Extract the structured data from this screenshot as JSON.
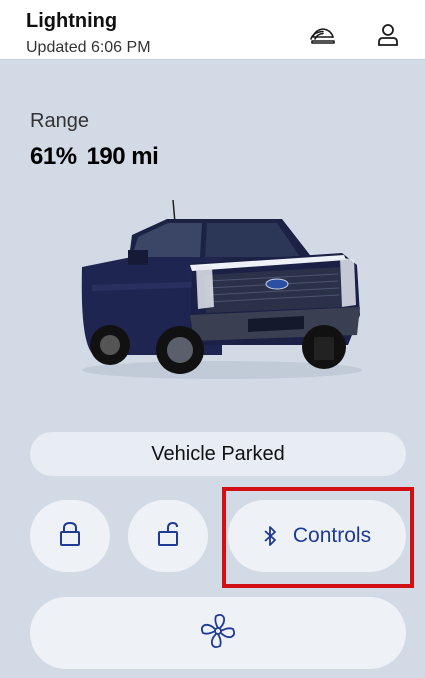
{
  "header": {
    "vehicle_name": "Lightning",
    "updated": "Updated 6:06 PM",
    "icons": [
      "car-wireless-icon",
      "user-icon"
    ]
  },
  "range": {
    "label": "Range",
    "percent": "61%",
    "distance": "190 mi"
  },
  "status": {
    "label": "Vehicle Parked"
  },
  "actions": {
    "lock_icon": "lock-icon",
    "unlock_icon": "unlock-icon",
    "controls_label": "Controls",
    "controls_icon": "bluetooth-icon",
    "climate_icon": "fan-icon"
  },
  "colors": {
    "accent": "#1f3a93",
    "highlight": "#d40f14",
    "background": "#d2dae6",
    "button": "#eef2f7"
  }
}
